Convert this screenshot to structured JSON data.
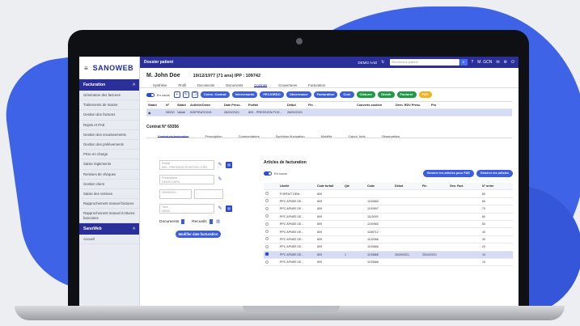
{
  "sidebar": {
    "logo": "SANOWEB",
    "section_facturation": "Facturation",
    "items": [
      "Génération des factures",
      "Traitements de masse",
      "Gestion des factures",
      "Rejets et PAE",
      "Gestion des encaissements",
      "Gestion des prélèvements",
      "Prise en charge",
      "Saisie règlements",
      "Remises de chèques",
      "Gestion client",
      "Saisie des remises",
      "Rapprochement manuel factures",
      "Rapprochement manuel écritures bancaires"
    ],
    "section_sanoweb": "SanoWeb",
    "bottom_item": "Accueil"
  },
  "topbar": {
    "title": "Dossier patient",
    "demo": "DEMO AAD",
    "search_placeholder": "Recherche patient",
    "user": "M. GCN"
  },
  "patient": {
    "name": "M. John Doe",
    "info": "19/12/1977 (71 ans) IPP : 109742"
  },
  "tabs": [
    "Synthèse",
    "Profil",
    "Documents",
    "Documents",
    "Contrats",
    "Couvertures",
    "Facturation"
  ],
  "actions": {
    "toggle_label": "En cours",
    "pills": [
      {
        "label": "Coteo. Contrat",
        "color": "#3b5ee0"
      },
      {
        "label": "Intervenants",
        "color": "#3b5ee0"
      },
      {
        "label": "PEC/ORDO",
        "color": "#3b5ee0"
      },
      {
        "label": "Observance",
        "color": "#3b5ee0"
      },
      {
        "label": "Facturation",
        "color": "#3b5ee0"
      },
      {
        "label": "Cure",
        "color": "#3b5ee0"
      },
      {
        "label": "Clôturer",
        "color": "#1f9a46"
      },
      {
        "label": "Dividir",
        "color": "#1f9a46"
      },
      {
        "label": "Facturer",
        "color": "#1f9a46"
      },
      {
        "label": "PAE",
        "color": "#f2b21c"
      }
    ]
  },
  "contracts_table": {
    "headers": [
      "Statut",
      "N°",
      "Statut",
      "Activité/Ordre",
      "Date Presc.",
      "Forfait",
      "Début",
      "Fin",
      "Couverts soutien",
      "Dern. RDV Presc.",
      "Pro"
    ],
    "row": [
      "",
      "59530",
      "Validé",
      "INSPIRATIONS",
      "28/09/2021",
      "809 - PRESSION POS...",
      "28/09/2021",
      "",
      "",
      "",
      ""
    ]
  },
  "control": {
    "title": "Contrat N° 69356",
    "tabs": [
      "Contrat de facturation",
      "Prescription",
      "Commentaires",
      "Synthèse fluctuation",
      "Mobilité",
      "Calcul. forfs",
      "Observables"
    ]
  },
  "left_form": {
    "field1_label": "Forfait",
    "field1_value": "809 - PRESSION POSITIVE CONT.",
    "field2_label": "Prescripteur",
    "field2_value": "DENIS DUPU",
    "date_from": "25/09/2021",
    "date_to": "",
    "field4_label": "Tiers",
    "field4_value": "59530",
    "documents_label": "Documents",
    "recueil_label": "Recueils",
    "modify_button": "Modifier date facturation"
  },
  "articles": {
    "title": "Articles de facturation",
    "toggle_label": "En cours",
    "btn_generate_fae": "Générer les articles pour FAE",
    "btn_generate": "Générer les articles",
    "headers": [
      "",
      "Libellé",
      "Code forfait",
      "Qté",
      "Code",
      "Début",
      "Fin",
      "Gen. Fact.",
      "N° ordre"
    ],
    "rows": [
      {
        "label": "FORFAIT DEM...",
        "forfait": "809",
        "qte": "",
        "code": "",
        "debut": "",
        "fin": "",
        "ordre": "80",
        "checked": false
      },
      {
        "label": "PPC APNEE DE...",
        "forfait": "809",
        "qte": "",
        "code": "1193663",
        "debut": "",
        "fin": "",
        "ordre": "80",
        "checked": false
      },
      {
        "label": "PPC APNEE DE...",
        "forfait": "809",
        "qte": "",
        "code": "1193997",
        "debut": "",
        "fin": "",
        "ordre": "70",
        "checked": false
      },
      {
        "label": "PPC APNEE DE...",
        "forfait": "809",
        "qte": "",
        "code": "1113093",
        "debut": "",
        "fin": "",
        "ordre": "60",
        "checked": false
      },
      {
        "label": "PPC APNEE DE...",
        "forfait": "809",
        "qte": "",
        "code": "1190983",
        "debut": "",
        "fin": "",
        "ordre": "50",
        "checked": false
      },
      {
        "label": "PPC APNEE DE...",
        "forfait": "809",
        "qte": "",
        "code": "1189712",
        "debut": "",
        "fin": "",
        "ordre": "40",
        "checked": false
      },
      {
        "label": "PPC APNEE DE...",
        "forfait": "809",
        "qte": "",
        "code": "1102066",
        "debut": "",
        "fin": "",
        "ordre": "30",
        "checked": false
      },
      {
        "label": "PPC APNEE DE...",
        "forfait": "809",
        "qte": "",
        "code": "1193666",
        "debut": "",
        "fin": "",
        "ordre": "20",
        "checked": false
      },
      {
        "label": "PPC APNEE DE...",
        "forfait": "809",
        "qte": "1",
        "code": "1193668",
        "debut": "26/09/2021",
        "fin": "25/10/2021",
        "ordre": "10",
        "checked": true
      },
      {
        "label": "PPC APNEE DE...",
        "forfait": "809",
        "qte": "",
        "code": "1193668",
        "debut": "",
        "fin": "",
        "ordre": "10",
        "checked": false
      }
    ]
  }
}
